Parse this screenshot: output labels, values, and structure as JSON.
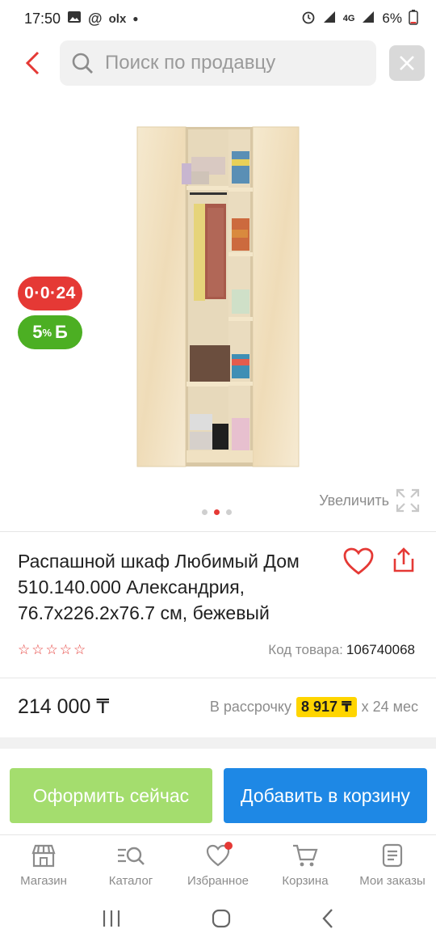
{
  "status_bar": {
    "time": "17:50",
    "battery": "6%",
    "notif_icons": [
      "image-icon",
      "at-icon",
      "olx-icon",
      "dot-icon"
    ],
    "olx_text": "olx"
  },
  "header": {
    "search_placeholder": "Поиск по продавцу"
  },
  "product": {
    "badge_installment": "0·0·24",
    "badge_bonus_value": "5",
    "badge_bonus_suffix": "%",
    "badge_bonus_unit": "Б",
    "zoom_label": "Увеличить",
    "gallery": {
      "count": 3,
      "active_index": 1
    },
    "title": "Распашной шкаф Любимый Дом 510.140.000 Александрия, 76.7x226.2x76.7 см, бежевый",
    "rating_stars": 5,
    "rating_value": 0,
    "code_label": "Код товара:",
    "code_value": "106740068",
    "price": "214 000 ₸",
    "installment_label": "В рассрочку",
    "installment_amount": "8 917 ₸",
    "installment_term": "x 24 мес"
  },
  "actions": {
    "buy_now": "Оформить сейчас",
    "add_to_cart": "Добавить в корзину"
  },
  "bottom_nav": [
    {
      "label": "Магазин",
      "icon": "shop-icon"
    },
    {
      "label": "Каталог",
      "icon": "catalog-search-icon"
    },
    {
      "label": "Избранное",
      "icon": "heart-icon",
      "has_dot": true
    },
    {
      "label": "Корзина",
      "icon": "cart-icon"
    },
    {
      "label": "Мои заказы",
      "icon": "orders-icon"
    }
  ],
  "colors": {
    "accent_red": "#e53935",
    "buy_now_green": "#a4dd6e",
    "cart_blue": "#1e88e5",
    "installment_yellow": "#ffd500",
    "bonus_green": "#4caf23"
  }
}
